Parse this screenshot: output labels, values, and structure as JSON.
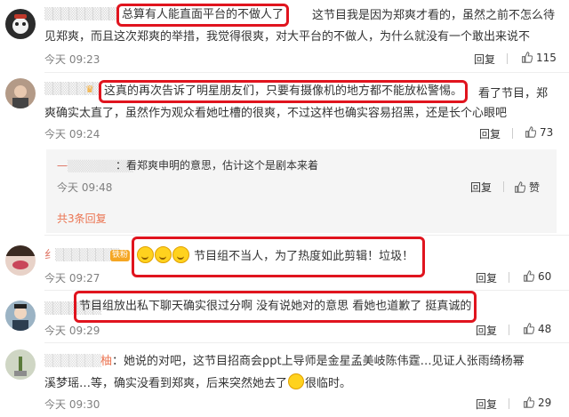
{
  "comments": [
    {
      "username": "",
      "text_hl": "总算有人能直面平台的不做人了",
      "text_line1": "这节目我是因为郑爽才看的，虽然之前不怎么待",
      "text_line2": "见郑爽，而且这次郑爽的举措，我觉得很爽，对大平台的不做人，为什么就没有一个敢出来说不",
      "time": "今天 09:23",
      "reply_label": "回复",
      "likes": "115"
    },
    {
      "username": "",
      "text_hl": "这真的再次告诉了明星朋友们，只要有摄像机的地方都不能放松警惕。",
      "text_line1": "看了节目，郑",
      "text_line2": "爽确实太直了，虽然作为观众看她吐槽的很爽，不过这样也确实容易招黑，还是长个心眼吧",
      "time": "今天 09:24",
      "reply_label": "回复",
      "likes": "73",
      "sub_reply": {
        "username": "一",
        "text": "看郑爽申明的意思，估计这个是剧本来着",
        "time": "今天 09:48",
        "reply_label": "回复",
        "like_label": "赞"
      },
      "more_replies": "共3条回复"
    },
    {
      "username": "纟",
      "badge": "铁粉",
      "text": "节目组不当人，为了热度如此剪辑！垃圾！",
      "time": "今天 09:27",
      "reply_label": "回复",
      "likes": "60"
    },
    {
      "username": "",
      "text": "节目组放出私下聊天确实很过分啊 没有说她对的意思 看她也道歉了 挺真诚的",
      "time": "今天 09:29",
      "reply_label": "回复",
      "likes": "48"
    },
    {
      "username": "柚",
      "text_line1": "她说的对吧，这节目招商会ppt上导师是金星孟美岐陈伟霆…见证人张雨绮杨幂",
      "text_line2a": "溪梦瑶…等，确实没看到郑爽，后来突然她去了",
      "text_line2b": "很临时。",
      "time": "今天 09:30",
      "reply_label": "回复",
      "likes": "29"
    }
  ]
}
